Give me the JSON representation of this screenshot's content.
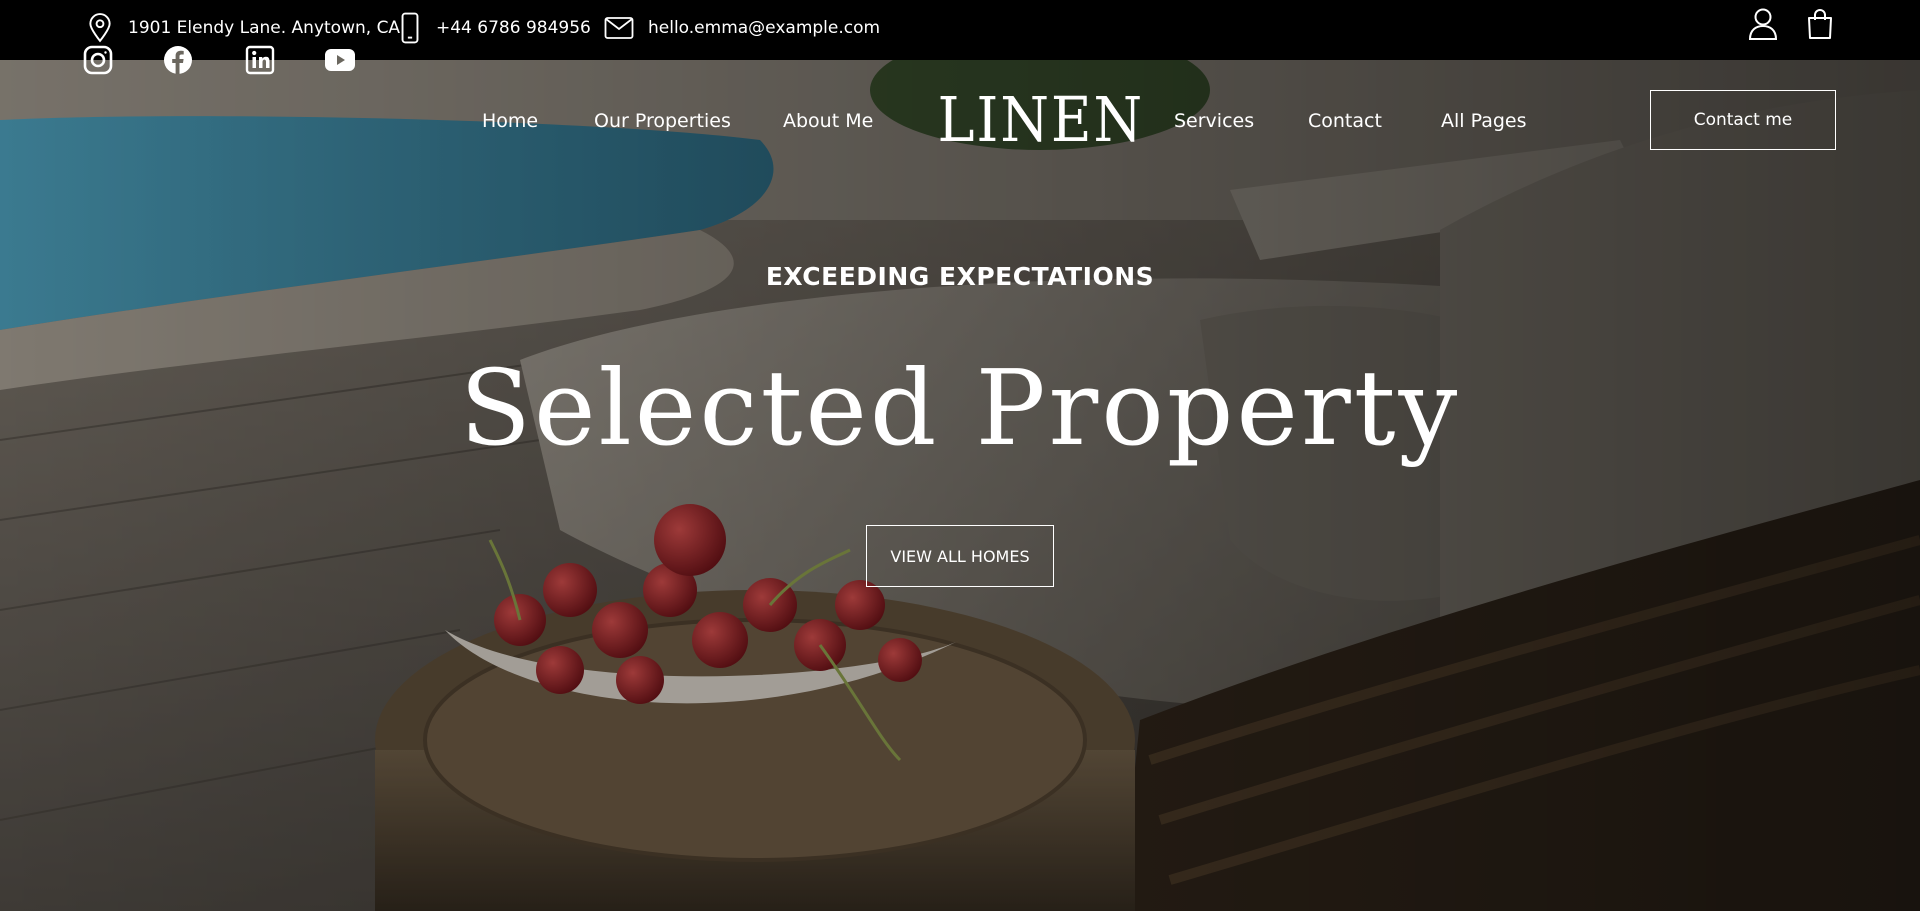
{
  "topbar": {
    "address": "1901 Elendy Lane. Anytown, CA",
    "phone": "+44 6786 984956",
    "email": "hello.emma@example.com",
    "icons": [
      "location-pin-icon",
      "phone-icon",
      "mail-icon",
      "user-icon",
      "shopping-bag-icon"
    ]
  },
  "social": [
    "instagram-icon",
    "facebook-icon",
    "linkedin-icon",
    "youtube-icon"
  ],
  "nav": {
    "left": [
      "Home",
      "Our Properties",
      "About Me"
    ],
    "logo": "LINEN",
    "right": [
      "Services",
      "Contact",
      "All Pages"
    ],
    "contact_button": "Contact me"
  },
  "hero": {
    "kicker": "EXCEEDING EXPECTATIONS",
    "headline": "Selected Property",
    "cta": "VIEW ALL HOMES"
  },
  "colors": {
    "topbar_bg": "#000000",
    "text": "#ffffff",
    "pool": "#3a8fb0",
    "cherry": "#9c1a24"
  }
}
